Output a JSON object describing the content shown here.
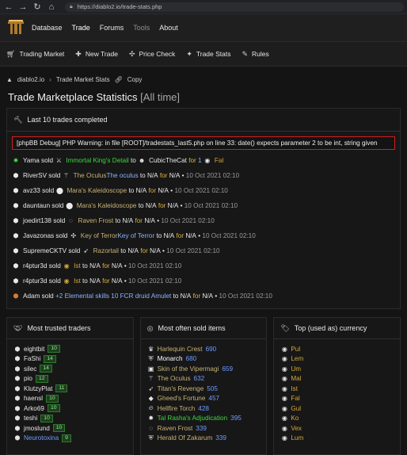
{
  "browser": {
    "url": "https://diablo2.io/trade-stats.php"
  },
  "top_nav": [
    "Database",
    "Trade",
    "Forums",
    "Tools",
    "About"
  ],
  "sub_nav": [
    {
      "label": "Trading Market",
      "icon": "cart-icon"
    },
    {
      "label": "New Trade",
      "icon": "new-trade-icon"
    },
    {
      "label": "Price Check",
      "icon": "price-check-icon"
    },
    {
      "label": "Trade Stats",
      "icon": "stats-icon"
    },
    {
      "label": "Rules",
      "icon": "rules-icon"
    }
  ],
  "breadcrumb": {
    "site": "diablo2.io",
    "page": "Trade Market Stats",
    "copy": "Copy"
  },
  "page_title": {
    "main": "Trade Marketplace Statistics",
    "range": "[All time]"
  },
  "last_trades": {
    "title": "Last 10 trades completed",
    "debug": "[phpBB Debug] PHP Warning: in file [ROOT]/tradestats_last5.php on line 33: date() expects parameter 2 to be int, string given",
    "trades": [
      {
        "user": "Yama",
        "item": "Immortal King's Detail",
        "to": "CubicTheCat",
        "for": "1",
        "currency": "Fal",
        "time": ""
      },
      {
        "user": "RiverSV",
        "item": "The Oculus",
        "item2": "The oculus",
        "to": "N/A",
        "for": "N/A",
        "time": "10 Oct 2021 02:10"
      },
      {
        "user": "avz33",
        "item": "Mara's Kaleidoscope",
        "to": "N/A",
        "for": "N/A",
        "time": "10 Oct 2021 02:10"
      },
      {
        "user": "dauntaun",
        "item": "Mara's Kaleidoscope",
        "to": "N/A",
        "for": "N/A",
        "time": "10 Oct 2021 02:10"
      },
      {
        "user": "joedirt138",
        "item": "Raven Frost",
        "to": "N/A",
        "for": "N/A",
        "time": "10 Oct 2021 02:10"
      },
      {
        "user": "Javazonas",
        "item": "Key of Terror",
        "item2": "Key of Terror",
        "to": "N/A",
        "for": "N/A",
        "time": "10 Oct 2021 02:10"
      },
      {
        "user": "SupremeCKTV",
        "item": "Razortail",
        "to": "N/A",
        "for": "N/A",
        "time": "10 Oct 2021 02:10"
      },
      {
        "user": "r4ptur3d",
        "item": "Ist",
        "to": "N/A",
        "for": "N/A",
        "time": "10 Oct 2021 02:10"
      },
      {
        "user": "r4ptur3d",
        "item": "Ist",
        "to": "N/A",
        "for": "N/A",
        "time": "10 Oct 2021 02:10"
      },
      {
        "user": "Adam",
        "item": "+2 Elemental skills 10 FCR druid Amulet",
        "to": "N/A",
        "for": "N/A",
        "time": "10 Oct 2021 02:10"
      }
    ]
  },
  "most_trusted": {
    "title": "Most trusted traders",
    "items": [
      {
        "name": "eightbit",
        "score": "10"
      },
      {
        "name": "FaShi",
        "score": "14"
      },
      {
        "name": "silec",
        "score": "14"
      },
      {
        "name": "pio",
        "score": "12"
      },
      {
        "name": "KlutzyPlat",
        "score": "11"
      },
      {
        "name": "haensl",
        "score": "10"
      },
      {
        "name": "Arko69",
        "score": "10"
      },
      {
        "name": "teshi",
        "score": "10"
      },
      {
        "name": "jmoslund",
        "score": "10"
      },
      {
        "name": "Neurotoxina",
        "score": "9"
      }
    ]
  },
  "most_sold": {
    "title": "Most often sold items",
    "items": [
      {
        "name": "Harlequin Crest",
        "value": "690"
      },
      {
        "name": "Monarch",
        "value": "680"
      },
      {
        "name": "Skin of the Vipermagi",
        "value": "659"
      },
      {
        "name": "The Oculus",
        "value": "632"
      },
      {
        "name": "Titan's Revenge",
        "value": "505"
      },
      {
        "name": "Gheed's Fortune",
        "value": "457"
      },
      {
        "name": "Hellfire Torch",
        "value": "428"
      },
      {
        "name": "Tal Rasha's Adjudication",
        "value": "395"
      },
      {
        "name": "Raven Frost",
        "value": "339"
      },
      {
        "name": "Herald Of Zakarum",
        "value": "339"
      }
    ]
  },
  "top_currency": {
    "title": "Top (used as) currency",
    "items": [
      "Pul",
      "Lem",
      "Um",
      "Mal",
      "Ist",
      "Fal",
      "Gul",
      "Ko",
      "Vex",
      "Lum"
    ]
  }
}
